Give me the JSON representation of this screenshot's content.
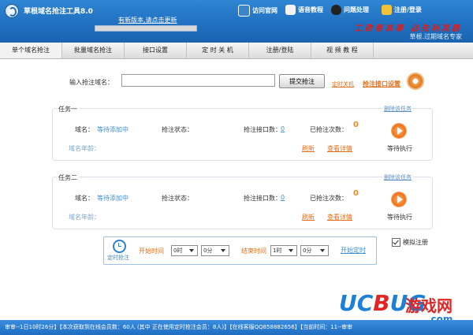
{
  "app": {
    "title": "草根域名抢注工具8.0",
    "update_link": "有新版本,请点击更新",
    "update_progress": 0,
    "slogan": "工欲善其事 必先利其器",
    "subslogan": "草根.过期域名专家"
  },
  "topnav": [
    {
      "label": "访问官网",
      "icon": "home-icon",
      "color": "#3a86cc"
    },
    {
      "label": "语音教程",
      "icon": "speaker-icon",
      "color": "#f2f2f2"
    },
    {
      "label": "问题处理",
      "icon": "qq-penguin-icon",
      "color": "#222222"
    },
    {
      "label": "注册/登录",
      "icon": "key-icon",
      "color": "#f4c23a"
    }
  ],
  "tabs": [
    "单个域名抢注",
    "批量域名抢注",
    "接口设置",
    "定 时 关 机",
    "注册/登陆",
    "视 频 教 程"
  ],
  "main": {
    "domain_label": "输入抢注域名：",
    "domain_value": "",
    "submit_label": "提交抢注",
    "timer_shutdown": "定时关机",
    "interface_settings": "抢注接口设置"
  },
  "tasks": [
    {
      "title": "任务一",
      "delete": "删除该任务",
      "domain_label": "域名：",
      "domain_value": "等待添加中",
      "status_label": "抢注状态：",
      "status_value": "",
      "ports_label": "抢注接口数：",
      "ports_value": "0",
      "attempts_label": "已抢注次数：",
      "attempts_value": "0",
      "age_label": "域名年龄：",
      "refresh": "刷新",
      "details": "查看详情",
      "state": "等待执行"
    },
    {
      "title": "任务二",
      "delete": "删除该任务",
      "domain_label": "域名：",
      "domain_value": "等待添加中",
      "status_label": "抢注状态：",
      "status_value": "",
      "ports_label": "抢注接口数：",
      "ports_value": "0",
      "attempts_label": "已抢注次数：",
      "attempts_value": "0",
      "age_label": "域名年龄：",
      "refresh": "刷新",
      "details": "查看详情",
      "state": "等待执行"
    }
  ],
  "timer": {
    "label": "定时抢注",
    "start_label": "开始时间",
    "start_hour": "0时",
    "start_min": "0分",
    "end_label": "结束时间",
    "end_hour": "1时",
    "end_min": "0分",
    "start_button": "开始定时",
    "simulate_label": "模拟注册",
    "simulate_checked": true
  },
  "status_bar": "审审--1日10时26分】【本次获取到在线会员数：60人 (其中 正在使用定时抢注会员：8人)】【在线客服QQ858882656】【当前时间：11--审审",
  "watermark": {
    "brand_uc": "UC",
    "brand_o": "B",
    "brand_rest": "UG",
    "cn": "游戏网",
    "com": ".com"
  }
}
